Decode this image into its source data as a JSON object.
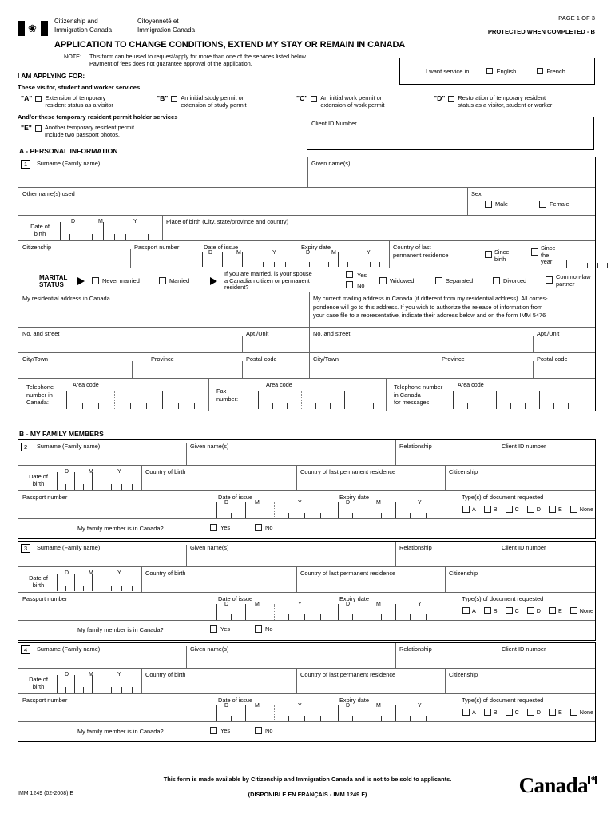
{
  "header": {
    "dept_en_l1": "Citizenship and",
    "dept_en_l2": "Immigration Canada",
    "dept_fr_l1": "Citoyenneté et",
    "dept_fr_l2": "Immigration Canada",
    "page_of": "PAGE 1 OF 3",
    "protected": "PROTECTED WHEN COMPLETED - B",
    "title": "APPLICATION TO CHANGE CONDITIONS, EXTEND MY STAY OR REMAIN IN CANADA",
    "note_label": "NOTE:",
    "note_line1": "This form can be used to request/apply for more than one of the services listed below.",
    "note_line2": "Payment of fees does not guarantee approval of the application.",
    "flag_leaf": "❀"
  },
  "service": {
    "label": "I want service in",
    "english": "English",
    "french": "French"
  },
  "applying": {
    "heading": "I AM APPLYING FOR:",
    "sub1": "These visitor, student and worker services",
    "sub2": "And/or these temporary resident permit holder services",
    "options": [
      {
        "key": "\"A\"",
        "l1": "Extension of temporary",
        "l2": "resident status as a visitor"
      },
      {
        "key": "\"B\"",
        "l1": "An initial study permit or",
        "l2": "extension of study permit"
      },
      {
        "key": "\"C\"",
        "l1": "An initial work permit or",
        "l2": "extension of work permit"
      },
      {
        "key": "\"D\"",
        "l1": "Restoration of temporary resident",
        "l2": "status as a visitor, student or worker"
      },
      {
        "key": "\"E\"",
        "l1": "Another temporary resident permit.",
        "l2": "Include two passport photos."
      }
    ],
    "client_id": "Client ID Number"
  },
  "sectionA": {
    "title": "A - PERSONAL INFORMATION",
    "num1": "1",
    "surname": "Surname (Family name)",
    "given_names": "Given name(s)",
    "other_names": "Other name(s) used",
    "sex": "Sex",
    "male": "Male",
    "female": "Female",
    "date_of_birth_l1": "Date of",
    "date_of_birth_l2": "birth",
    "d": "D",
    "m": "M",
    "y": "Y",
    "place_of_birth": "Place of birth (City, state/province and country)",
    "citizenship": "Citizenship",
    "passport_number": "Passport number",
    "date_of_issue": "Date of issue",
    "expiry_date": "Expiry date",
    "country_last_res_l1": "Country of last",
    "country_last_res_l2": "permanent residence",
    "since_birth_l1": "Since",
    "since_birth_l2": "birth",
    "since_year_l1": "Since",
    "since_year_l2": "the",
    "since_year_l3": "year",
    "marital_l1": "MARITAL",
    "marital_l2": "STATUS",
    "never_married": "Never married",
    "married": "Married",
    "spouse_q_l1": "If you are married, is your spouse",
    "spouse_q_l2": "a Canadian citizen or permanent",
    "spouse_q_l3": "resident?",
    "yes": "Yes",
    "no": "No",
    "widowed": "Widowed",
    "separated": "Separated",
    "divorced": "Divorced",
    "commonlaw_l1": "Common-law",
    "commonlaw_l2": "partner",
    "res_address": "My residential address in Canada",
    "mail_address_l1": "My current mailing address in Canada (if different from my residential address). All corres-",
    "mail_address_l2": "pondence will go to this address. If you wish to authorize the release of information from",
    "mail_address_l3": "your case file to a representative, indicate their address below and on the form IMM 5476",
    "no_and_street": "No. and street",
    "apt_unit": "Apt./Unit",
    "city_town": "City/Town",
    "province": "Province",
    "postal_code": "Postal code",
    "tel_l1": "Telephone",
    "tel_l2": "number in",
    "tel_l3": "Canada:",
    "area_code": "Area code",
    "fax_l1": "Fax",
    "fax_l2": "number:",
    "telmsg_l1": "Telephone number",
    "telmsg_l2": "in Canada",
    "telmsg_l3": "for messages:"
  },
  "sectionB": {
    "title": "B - MY FAMILY MEMBERS",
    "surname": "Surname (Family name)",
    "given_names": "Given name(s)",
    "relationship": "Relationship",
    "client_id_number": "Client ID number",
    "date_of_birth_l1": "Date of",
    "date_of_birth_l2": "birth",
    "d": "D",
    "m": "M",
    "y": "Y",
    "country_of_birth": "Country of birth",
    "country_last_res": "Country of last permanent residence",
    "citizenship": "Citizenship",
    "passport_number": "Passport number",
    "date_of_issue": "Date of issue",
    "expiry_date": "Expiry date",
    "doc_types": "Type(s) of document requested",
    "doc_options": [
      "A",
      "B",
      "C",
      "D",
      "E",
      "None"
    ],
    "in_canada_q": "My family member is in Canada?",
    "yes": "Yes",
    "no": "No",
    "members": [
      {
        "num": "2"
      },
      {
        "num": "3"
      },
      {
        "num": "4"
      }
    ]
  },
  "footer": {
    "line1": "This form is made available by Citizenship and Immigration Canada and is not to be sold to applicants.",
    "line2": "(DISPONIBLE EN FRANÇAIS - IMM 1249 F)",
    "imm": "IMM 1249 (02-2008) E",
    "wordmark": "Canada",
    "flag_leaf": "❀"
  }
}
